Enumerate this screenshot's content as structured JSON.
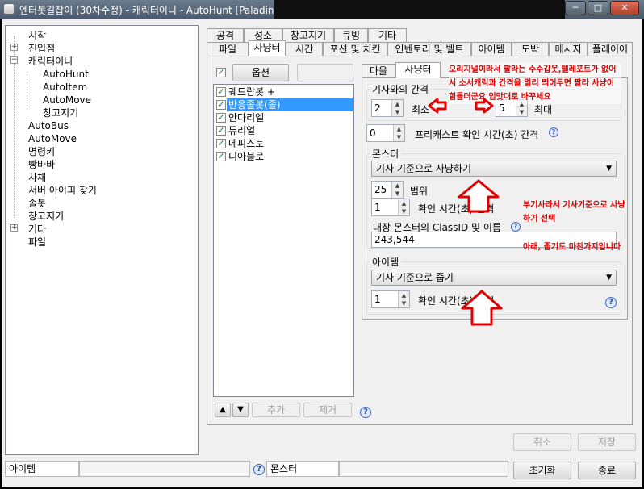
{
  "window": {
    "title": "엔터봇길잡이 (30차수정) - 캐릭터이니 - AutoHunt [Paladin:",
    "min_glyph": "─",
    "max_glyph": "□",
    "close_glyph": "✕"
  },
  "tree": {
    "items": [
      {
        "label": "시작",
        "expander": ""
      },
      {
        "label": "진입점",
        "expander": "+"
      },
      {
        "label": "캐릭터이니",
        "expander": "−"
      },
      {
        "label": "AutoHunt",
        "expander": ""
      },
      {
        "label": "AutoItem",
        "expander": ""
      },
      {
        "label": "AutoMove",
        "expander": ""
      },
      {
        "label": "창고지기",
        "expander": ""
      },
      {
        "label": "AutoBus",
        "expander": ""
      },
      {
        "label": "AutoMove",
        "expander": ""
      },
      {
        "label": "명령키",
        "expander": ""
      },
      {
        "label": "빵바바",
        "expander": ""
      },
      {
        "label": "사채",
        "expander": ""
      },
      {
        "label": "서버 아이피 찾기",
        "expander": ""
      },
      {
        "label": "졸봇",
        "expander": ""
      },
      {
        "label": "창고지기",
        "expander": ""
      },
      {
        "label": "기타",
        "expander": "+"
      },
      {
        "label": "파일",
        "expander": ""
      }
    ]
  },
  "tabs": {
    "row1": [
      "공격",
      "성소",
      "창고지기",
      "큐빙",
      "기타"
    ],
    "row2": [
      "파일",
      "사냥터",
      "시간",
      "포션 및 치킨",
      "인벤토리 및 벨트",
      "아이템",
      "도박",
      "메시지",
      "플레이어"
    ]
  },
  "left_panel": {
    "options_button": "옵션",
    "list": [
      "퀘드랍봇 +",
      "반응졸봇(졸)",
      "안다리엘",
      "듀리얼",
      "메피스토",
      "디아블로"
    ],
    "up_arrow": "▲",
    "down_arrow": "▼",
    "add_button": "추가",
    "remove_button": "제거"
  },
  "subtabs": [
    "마을",
    "사냥터"
  ],
  "hunt": {
    "distance_group_title": "기사와의 간격",
    "min_value": "2",
    "min_label": "최소",
    "max_value": "5",
    "max_label": "최대",
    "precast_value": "0",
    "precast_label": "프리캐스트 확인 시간(초) 간격",
    "monster_group_title": "몬스터",
    "monster_combo": "기사 기준으로 사냥하기",
    "range_value": "25",
    "range_label": "범위",
    "monster_check_value": "1",
    "monster_check_label": "확인 시간(초) 간격",
    "target_label": "대장 몬스터의 ClassID 및 이름",
    "target_value": "243,544",
    "item_group_title": "아이템",
    "item_combo": "기사 기준으로 줍기",
    "item_check_value": "1",
    "item_check_label": "확인 시간(초) 간격"
  },
  "annotations": {
    "note1": "오리지널이라서 팔라는 수수갑옷,텔레포트가 없어서 소서캐릭과 간격을 멀리 띄어두면 팔라 사냥이 힘들더군요 입맛대로 바꾸세요",
    "note2": "부기사라서 기사기준으로 사냥하기 선택",
    "note3": "아래, 줍기도 마찬가지입니다"
  },
  "footer": {
    "cancel_button": "취소",
    "save_button": "저장",
    "reset_button": "초기화",
    "exit_button": "종료",
    "status_left": "아이템",
    "status_mid": "몬스터",
    "help_glyph": "?"
  },
  "colors": {
    "annotation_red": "#e00000",
    "selection_blue": "#3399ff",
    "titlebar": "#5a6a7c"
  }
}
